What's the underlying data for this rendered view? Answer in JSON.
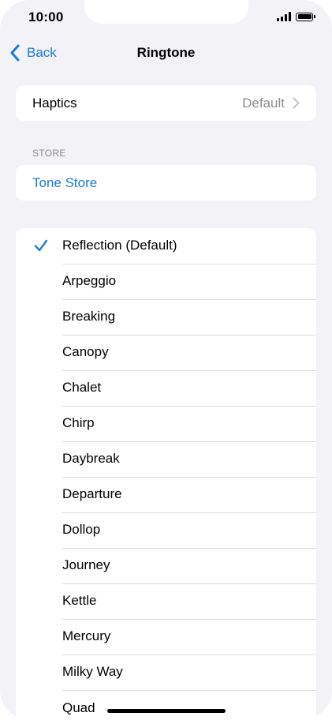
{
  "status_bar": {
    "time": "10:00"
  },
  "nav": {
    "back_label": "Back",
    "title": "Ringtone"
  },
  "haptics": {
    "label": "Haptics",
    "value": "Default"
  },
  "store": {
    "header": "STORE",
    "tone_store_label": "Tone Store"
  },
  "ringtones": {
    "selected": "Reflection (Default)",
    "items": [
      "Reflection (Default)",
      "Arpeggio",
      "Breaking",
      "Canopy",
      "Chalet",
      "Chirp",
      "Daybreak",
      "Departure",
      "Dollop",
      "Journey",
      "Kettle",
      "Mercury",
      "Milky Way",
      "Quad"
    ]
  },
  "colors": {
    "accent": "#1a7cd8",
    "background": "#f2f2f7",
    "secondary_text": "#8e8e93"
  }
}
